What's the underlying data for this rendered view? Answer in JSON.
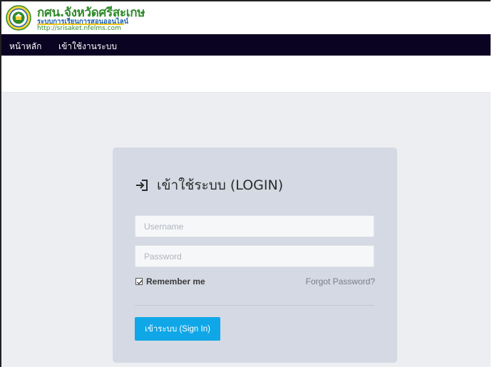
{
  "header": {
    "brand_title": "กศน.จังหวัดศรีสะเกษ",
    "brand_subtitle": "ระบบการเรียนการสอนออนไลน์",
    "brand_url": "http://srisaket.nfelms.com"
  },
  "nav": {
    "items": [
      {
        "label": "หน้าหลัก"
      },
      {
        "label": "เข้าใช้งานระบบ"
      }
    ]
  },
  "login": {
    "title": "เข้าใช้ระบบ (LOGIN)",
    "username_placeholder": "Username",
    "password_placeholder": "Password",
    "remember_label": "Remember me",
    "remember_checked": true,
    "forgot_label": "Forgot Password?",
    "signin_label": "เข้าระบบ (Sign In)"
  },
  "colors": {
    "navbar": "#0b0322",
    "card": "#d4d9e3",
    "signin_button": "#10a7e8",
    "brand_green": "#2f8a2a",
    "brand_blue": "#1b5fb0"
  }
}
